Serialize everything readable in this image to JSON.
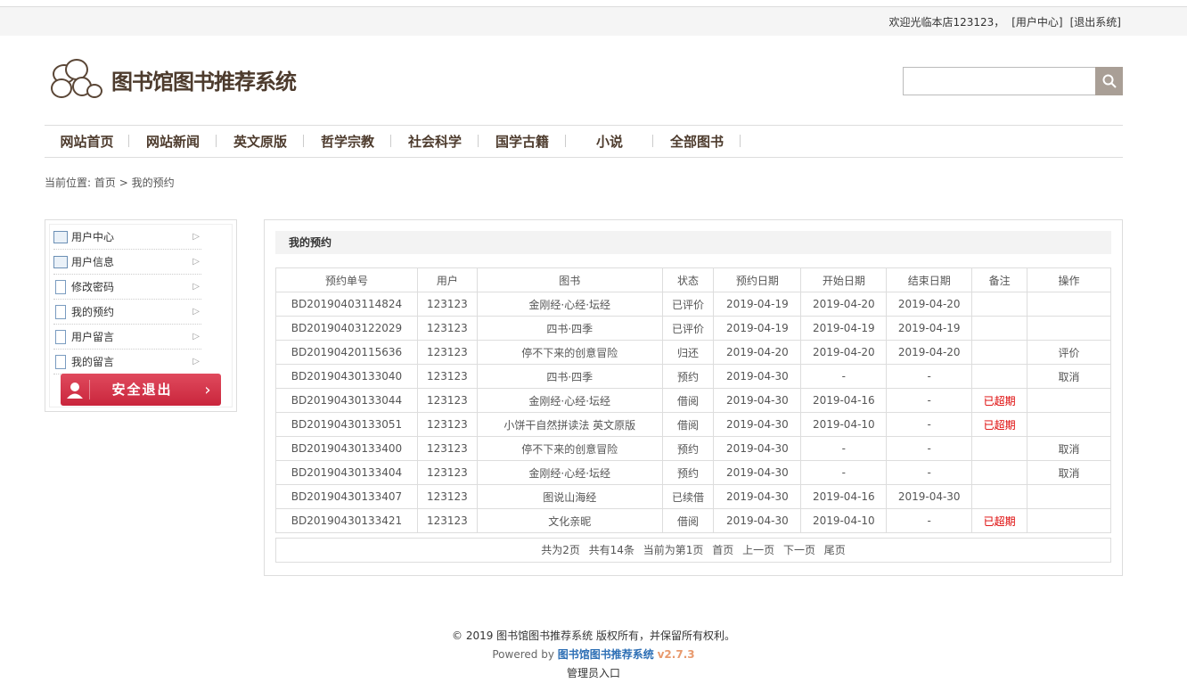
{
  "topbar": {
    "welcome": "欢迎光临本店123123，",
    "user_center": "[用户中心]",
    "logout": "[退出系统]"
  },
  "brand": {
    "name": "图书馆图书推荐系统"
  },
  "search": {
    "placeholder": ""
  },
  "nav": [
    {
      "label": "网站首页"
    },
    {
      "label": "网站新闻"
    },
    {
      "label": "英文原版"
    },
    {
      "label": "哲学宗教"
    },
    {
      "label": "社会科学"
    },
    {
      "label": "国学古籍"
    },
    {
      "label": "小说"
    },
    {
      "label": "全部图书"
    }
  ],
  "breadcrumb": {
    "prefix": "当前位置:",
    "home": "首页",
    "sep": ">",
    "current": "我的预约"
  },
  "sidebar": {
    "items": [
      {
        "label": "用户中心",
        "icon": "id-card-icon"
      },
      {
        "label": "用户信息",
        "icon": "id-card-icon"
      },
      {
        "label": "修改密码",
        "icon": "document-icon"
      },
      {
        "label": "我的预约",
        "icon": "document-icon"
      },
      {
        "label": "用户留言",
        "icon": "document-icon"
      },
      {
        "label": "我的留言",
        "icon": "document-icon"
      }
    ],
    "logout_label": "安全退出"
  },
  "panel": {
    "title": "我的预约"
  },
  "table": {
    "headers": [
      "预约单号",
      "用户",
      "图书",
      "状态",
      "预约日期",
      "开始日期",
      "结束日期",
      "备注",
      "操作"
    ],
    "rows": [
      [
        "BD20190403114824",
        "123123",
        "金刚经·心经·坛经",
        "已评价",
        "2019-04-19",
        "2019-04-20",
        "2019-04-20",
        "",
        ""
      ],
      [
        "BD20190403122029",
        "123123",
        "四书·四季",
        "已评价",
        "2019-04-19",
        "2019-04-19",
        "2019-04-19",
        "",
        ""
      ],
      [
        "BD20190420115636",
        "123123",
        "停不下来的创意冒险",
        "归还",
        "2019-04-20",
        "2019-04-20",
        "2019-04-20",
        "",
        "评价"
      ],
      [
        "BD20190430133040",
        "123123",
        "四书·四季",
        "预约",
        "2019-04-30",
        "-",
        "-",
        "",
        "取消"
      ],
      [
        "BD20190430133044",
        "123123",
        "金刚经·心经·坛经",
        "借阅",
        "2019-04-30",
        "2019-04-16",
        "-",
        "已超期",
        ""
      ],
      [
        "BD20190430133051",
        "123123",
        "小饼干自然拼读法 英文原版",
        "借阅",
        "2019-04-30",
        "2019-04-10",
        "-",
        "已超期",
        ""
      ],
      [
        "BD20190430133400",
        "123123",
        "停不下来的创意冒险",
        "预约",
        "2019-04-30",
        "-",
        "-",
        "",
        "取消"
      ],
      [
        "BD20190430133404",
        "123123",
        "金刚经·心经·坛经",
        "预约",
        "2019-04-30",
        "-",
        "-",
        "",
        "取消"
      ],
      [
        "BD20190430133407",
        "123123",
        "图说山海经",
        "已续借",
        "2019-04-30",
        "2019-04-16",
        "2019-04-30",
        "",
        ""
      ],
      [
        "BD20190430133421",
        "123123",
        "文化亲昵",
        "借阅",
        "2019-04-30",
        "2019-04-10",
        "-",
        "已超期",
        ""
      ]
    ]
  },
  "pager": {
    "total_pages": "共为2页",
    "total_items": "共有14条",
    "current": "当前为第1页",
    "first": "首页",
    "prev": "上一页",
    "next": "下一页",
    "last": "尾页"
  },
  "footer": {
    "copyright": "© 2019 图书馆图书推荐系统 版权所有，并保留所有权利。",
    "powered_prefix": "Powered by",
    "powered_name": "图书馆图书推荐系统",
    "version": "v2.7.3",
    "admin": "管理员入口"
  },
  "colors": {
    "brand": "#4d3b2d",
    "logout_red": "#d2344a",
    "overdue": "#dd0000",
    "footer_link": "#2d6fb5"
  }
}
